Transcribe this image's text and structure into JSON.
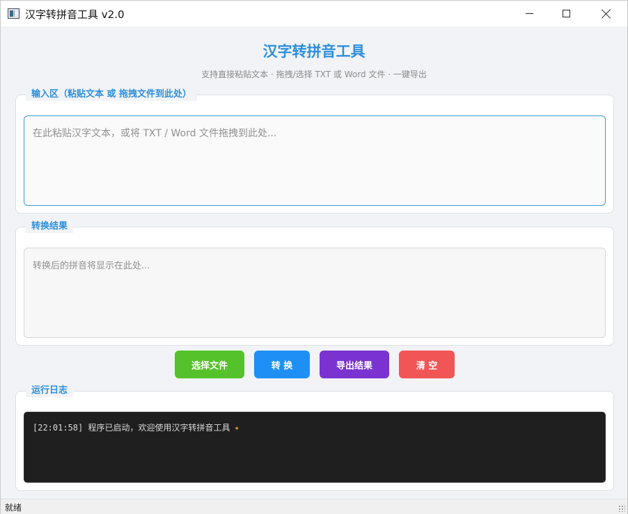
{
  "window": {
    "title": "汉字转拼音工具 v2.0"
  },
  "header": {
    "title": "汉字转拼音工具",
    "subtitle": "支持直接粘贴文本 · 拖拽/选择 TXT 或 Word 文件 · 一键导出"
  },
  "input_section": {
    "title": "输入区（粘贴文本 或 拖拽文件到此处）",
    "placeholder": "在此粘贴汉字文本，或将 TXT / Word 文件拖拽到此处...",
    "value": ""
  },
  "result_section": {
    "title": "转换结果",
    "placeholder": "转换后的拼音将显示在此处...",
    "value": ""
  },
  "buttons": {
    "select_file": "选择文件",
    "convert": "转 换",
    "export": "导出结果",
    "clear": "清 空"
  },
  "colors": {
    "accent": "#2d8fdc",
    "select_file": "#55c22b",
    "convert": "#1e90f5",
    "export": "#7a33d1",
    "clear": "#f15555"
  },
  "log_section": {
    "title": "运行日志",
    "entries": [
      {
        "time": "[22:01:58]",
        "message": "程序已启动，欢迎使用汉字转拼音工具",
        "icon": "party-popper-icon"
      }
    ]
  },
  "statusbar": {
    "text": "就绪"
  }
}
